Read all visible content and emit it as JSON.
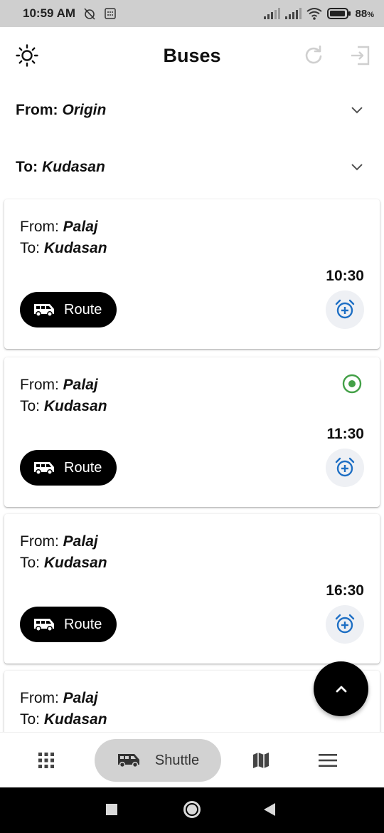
{
  "status_bar": {
    "time": "10:59 AM",
    "battery": "88",
    "battery_unit": "%"
  },
  "header": {
    "title": "Buses",
    "left_icon": "brightness-icon",
    "right_icons": [
      "refresh-icon",
      "logout-icon"
    ]
  },
  "filters": {
    "from_label": "From:",
    "from_value": "Origin",
    "to_label": "To:",
    "to_value": "Kudasan"
  },
  "cards": [
    {
      "from_label": "From:",
      "from": "Palaj",
      "to_label": "To:",
      "to": "Kudasan",
      "time": "10:30",
      "route_label": "Route",
      "live": false
    },
    {
      "from_label": "From:",
      "from": "Palaj",
      "to_label": "To:",
      "to": "Kudasan",
      "time": "11:30",
      "route_label": "Route",
      "live": true
    },
    {
      "from_label": "From:",
      "from": "Palaj",
      "to_label": "To:",
      "to": "Kudasan",
      "time": "16:30",
      "route_label": "Route",
      "live": false
    },
    {
      "from_label": "From:",
      "from": "Palaj",
      "to_label": "To:",
      "to": "Kudasan"
    }
  ],
  "bottom_nav": {
    "items": [
      "grid-icon",
      "shuttle",
      "map-icon",
      "menu-icon"
    ],
    "active_label": "Shuttle"
  },
  "colors": {
    "accent_blue": "#1e6fc4",
    "live_green": "#43a047",
    "primary_black": "#000000"
  }
}
